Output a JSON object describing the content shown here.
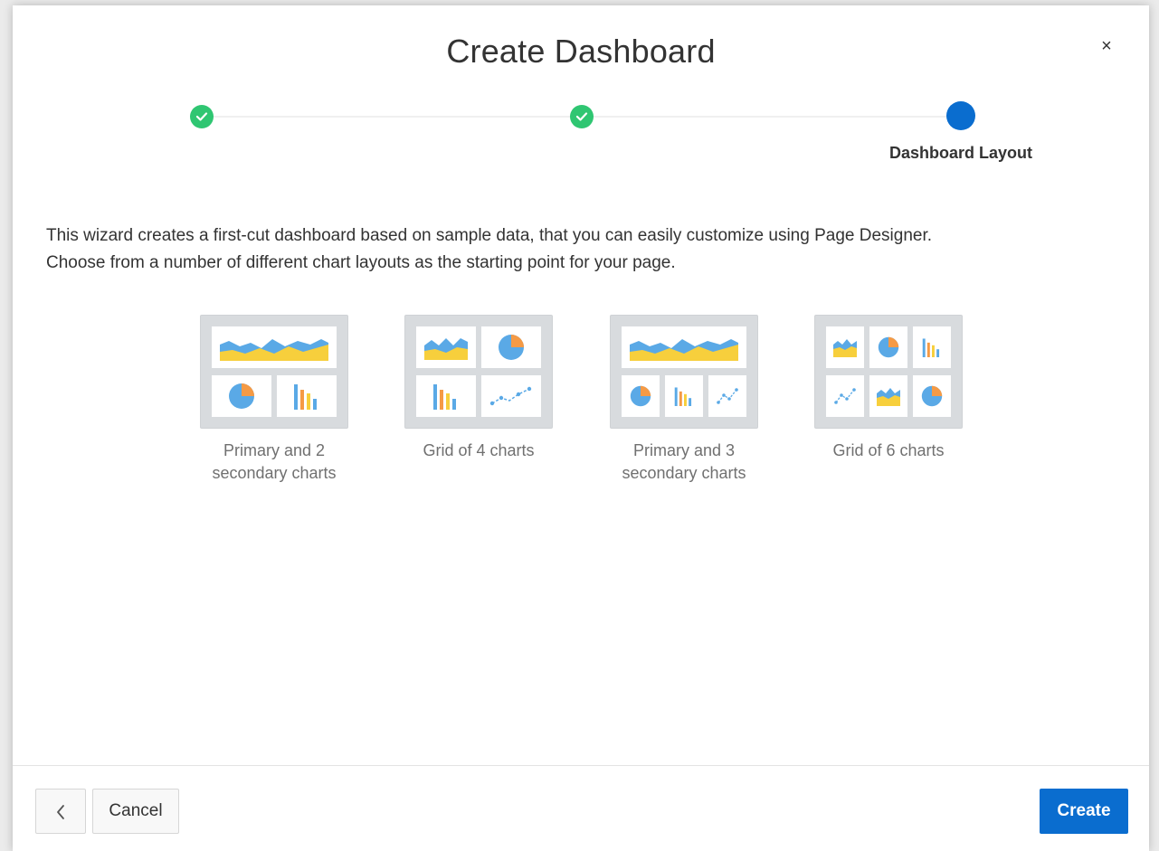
{
  "dialog": {
    "title": "Create Dashboard",
    "close_label": "×"
  },
  "wizard": {
    "current_step_label": "Dashboard Layout",
    "colors": {
      "done": "#2fc672",
      "current": "#0a6dcf"
    }
  },
  "intro": {
    "line1": "This wizard creates a first-cut dashboard based on sample data, that you can easily customize using Page Designer.",
    "line2": "Choose from a number of different chart layouts as the starting point for your page."
  },
  "layouts": [
    {
      "line1": "Primary and 2",
      "line2": "secondary charts"
    },
    {
      "line1": "Grid of 4 charts",
      "line2": ""
    },
    {
      "line1": "Primary and 3",
      "line2": "secondary charts"
    },
    {
      "line1": "Grid of 6 charts",
      "line2": ""
    }
  ],
  "footer": {
    "cancel_label": "Cancel",
    "create_label": "Create"
  },
  "theme": {
    "chart_blue": "#5aa9e6",
    "chart_yellow": "#f7cf3c",
    "chart_orange": "#f59a45"
  }
}
